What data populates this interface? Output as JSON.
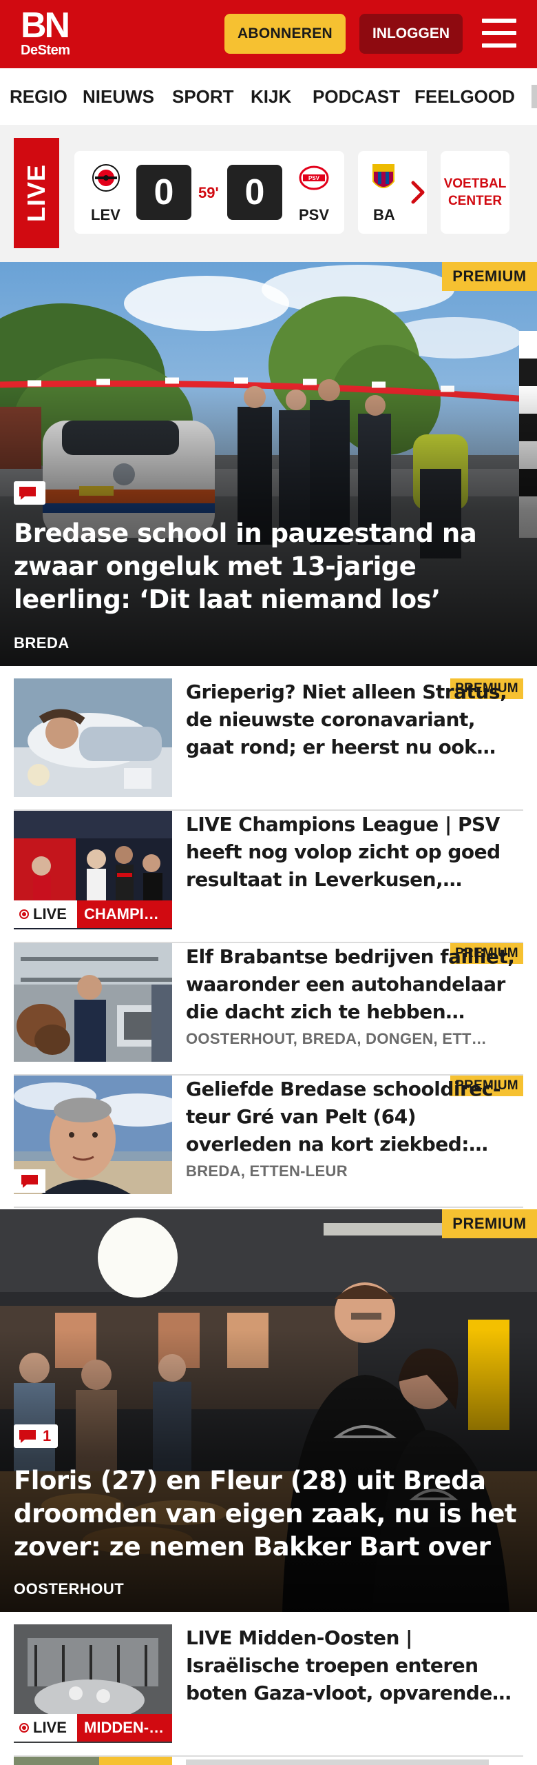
{
  "header": {
    "logo_main": "BN",
    "logo_sub": "DeStem",
    "subscribe_label": "ABONNEREN",
    "login_label": "INLOGGEN",
    "brand_color": "#d10a11",
    "menu_icon": "hamburger-icon"
  },
  "nav": {
    "items": [
      "REGIO",
      "NIEUWS",
      "SPORT",
      "KIJK",
      "PODCAST",
      "FEELGOOD"
    ]
  },
  "live": {
    "tag": "LIVE",
    "match": {
      "home_abbr": "LEV",
      "home_score": "0",
      "minute": "59'",
      "away_score": "0",
      "away_abbr": "PSV"
    },
    "next_match_abbr": "BA",
    "center_label_1": "VOETBAL",
    "center_label_2": "CENTER"
  },
  "hero1": {
    "premium": "PREMIUM",
    "title": "Bredase school in pauzestand na zwaar ongeluk met 13-jarige leerling: ‘Dit laat niemand los’",
    "location": "BREDA"
  },
  "articles": [
    {
      "premium": "PREMIUM",
      "title": "Grieperig? Niet alleen Stratus, de nieuwste coronavariant, gaat rond; er heerst nu ook het…",
      "location": ""
    },
    {
      "premium": "",
      "title": "LIVE Champions League | PSV heeft nog volop zicht op goed resultaat in Leverkusen, Saibari…",
      "live_label": "LIVE",
      "live_category": "CHAMPI…"
    },
    {
      "premium": "PREMIUM",
      "title": "Elf Brabantse bedrijven failliet, waaronder een autohandelaar die dacht zich te hebben herpakt",
      "location": "OOSTERHOUT, BREDA, DONGEN, ETT…"
    },
    {
      "premium": "PREMIUM",
      "title": "Geliefde Bredase schooldirec­teur Gré van Pelt (64) overleden na kort ziekbed: ‘Strijder voor…",
      "location": "BREDA, ETTEN-LEUR"
    }
  ],
  "hero2": {
    "premium": "PREMIUM",
    "comment_count": "1",
    "title": "Floris (27) en Fleur (28) uit Breda droomden van eigen zaak, nu is het zover: ze nemen Bakker Bart over",
    "location": "OOSTERHOUT"
  },
  "article_last": {
    "title": "LIVE Midden-Oosten | Israëlische troepen enteren boten Gaza-vloot, opvarenden zeggen te…",
    "live_label": "LIVE",
    "live_category": "MIDDEN-…"
  },
  "partial": {
    "premium": "PREMIUM"
  }
}
